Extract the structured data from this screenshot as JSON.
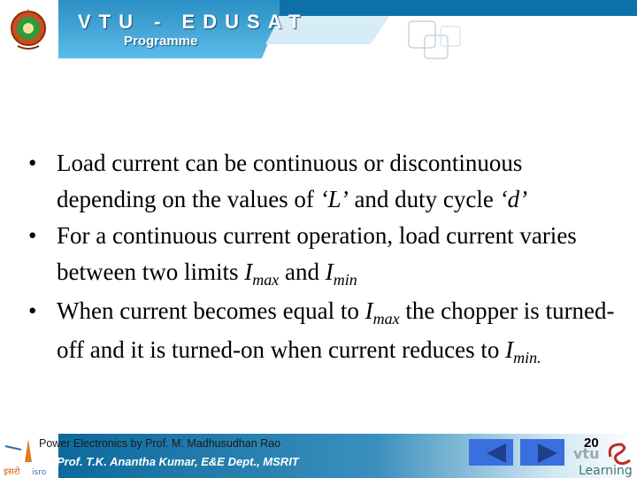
{
  "header": {
    "title": "VTU - EDUSAT",
    "subtitle": "Programme"
  },
  "content": {
    "bullets": [
      {
        "text_before": "Load current can be continuous or discontinuous depending on the values of ",
        "L": "‘L’",
        "text_mid": " and duty cycle ",
        "d": "‘d’"
      },
      {
        "text_before": "For a continuous current operation, load current varies between two limits ",
        "i1": "I",
        "i1_sub": "max",
        "text_mid": " and ",
        "i2": "I",
        "i2_sub": "min"
      },
      {
        "text_before": "When current becomes equal to ",
        "i1": "I",
        "i1_sub": "max",
        "text_mid": " the chopper is turned-off and it is turned-on when current reduces to ",
        "i2": "I",
        "i2_sub": "min."
      }
    ],
    "bullet_glyph": "•"
  },
  "footer": {
    "course": "Power Electronics by Prof. M. Madhusudhan Rao",
    "author": "Prof. T.K. Anantha Kumar,  E&E Dept.,  MSRIT",
    "page_number": "20",
    "isro_label": "इसरो isro",
    "elearning_label": "vtu Learning",
    "prev_icon": "triangle-left-icon",
    "next_icon": "triangle-right-icon"
  }
}
